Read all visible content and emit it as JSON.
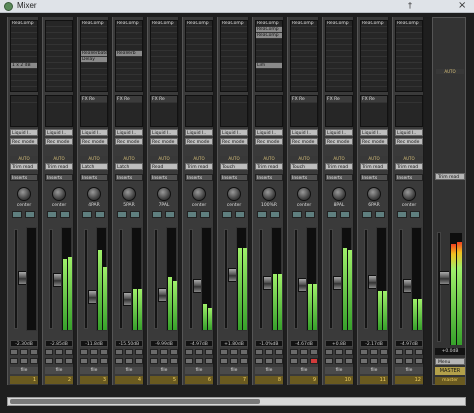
{
  "window": {
    "title": "Mixer",
    "pin_glyph": "†",
    "close_glyph": "×"
  },
  "strips": [
    {
      "fx": [
        "ReaComp",
        "",
        "",
        "",
        "",
        "",
        "",
        "1 x 2 dB",
        "",
        "",
        ""
      ],
      "send": "",
      "input": "Liquid I..",
      "recmode": "Rec mode",
      "automode": "Trim read",
      "auto": "AUTO",
      "inserts": "Inserts",
      "pan": "center",
      "db": "-2.30dB",
      "name": "",
      "num": "1",
      "meter": [
        0.0,
        0.0
      ],
      "fader": 0.52
    },
    {
      "fx": [
        "",
        "",
        "",
        "",
        "",
        "",
        "",
        "",
        "",
        "",
        ""
      ],
      "send": "",
      "input": "Liquid I..",
      "recmode": "Rec mode",
      "automode": "Trim read",
      "auto": "AUTO",
      "inserts": "Inserts",
      "pan": "center",
      "db": "-2.85dB",
      "name": "",
      "num": "2",
      "meter": [
        0.7,
        0.72
      ],
      "fader": 0.5
    },
    {
      "fx": [
        "ReaComp",
        "",
        "",
        "",
        "",
        "ReaVerbate",
        "Delay",
        "",
        "",
        "",
        ""
      ],
      "send": "FX Re",
      "input": "Liquid I..",
      "recmode": "Rec mode",
      "automode": "Latch",
      "auto": "AUTO",
      "inserts": "Inserts",
      "pan": "4PAR",
      "db": "-11.8dB",
      "name": "",
      "num": "3",
      "meter": [
        0.78,
        0.62
      ],
      "fader": 0.3
    },
    {
      "fx": [
        "ReaComp",
        "",
        "",
        "",
        "",
        "ReaVerb",
        "",
        "",
        "",
        "",
        ""
      ],
      "send": "FX Re",
      "input": "Liquid I..",
      "recmode": "Rec mode",
      "automode": "Latch",
      "auto": "AUTO",
      "inserts": "Inserts",
      "pan": "5PAR",
      "db": "-15.50dB",
      "name": "",
      "num": "4",
      "meter": [
        0.4,
        0.4
      ],
      "fader": 0.28
    },
    {
      "fx": [
        "ReaComp",
        "",
        "",
        "",
        "",
        "",
        "",
        "",
        "",
        "",
        ""
      ],
      "send": "FX Re",
      "input": "Liquid I..",
      "recmode": "Rec mode",
      "automode": "Read",
      "auto": "AUTO",
      "inserts": "Inserts",
      "pan": "7PAL",
      "db": "-9.99dB",
      "name": "",
      "num": "5",
      "meter": [
        0.52,
        0.48
      ],
      "fader": 0.33
    },
    {
      "fx": [
        "ReaComp",
        "",
        "",
        "",
        "",
        "",
        "",
        "",
        "",
        "",
        ""
      ],
      "send": "",
      "input": "Liquid I..",
      "recmode": "Rec mode",
      "automode": "Trim read",
      "auto": "AUTO",
      "inserts": "Inserts",
      "pan": "center",
      "db": "-4.97dB",
      "name": "",
      "num": "6",
      "meter": [
        0.25,
        0.22
      ],
      "fader": 0.43
    },
    {
      "fx": [
        "ReaComp",
        "",
        "",
        "",
        "",
        "",
        "",
        "",
        "",
        "",
        ""
      ],
      "send": "",
      "input": "Liquid I..",
      "recmode": "Rec mode",
      "automode": "Touch",
      "auto": "AUTO",
      "inserts": "Inserts",
      "pan": "center",
      "db": "+1.80dB",
      "name": "",
      "num": "7",
      "meter": [
        0.8,
        0.8
      ],
      "fader": 0.56
    },
    {
      "fx": [
        "ReaComp",
        "ReaComp",
        "ReaComp",
        "",
        "",
        "",
        "",
        "Lim",
        "",
        "",
        ""
      ],
      "send": "",
      "input": "Liquid I..",
      "recmode": "Rec mode",
      "automode": "Trim read",
      "auto": "AUTO",
      "inserts": "Inserts",
      "pan": "100%R",
      "db": "-1.0%dB",
      "name": "",
      "num": "8",
      "meter": [
        0.55,
        0.55
      ],
      "fader": 0.46
    },
    {
      "fx": [
        "ReaComp",
        "",
        "",
        "",
        "",
        "",
        "",
        "",
        "",
        "",
        ""
      ],
      "send": "FX Re",
      "input": "Liquid I..",
      "recmode": "Rec mode",
      "automode": "Touch",
      "auto": "AUTO",
      "inserts": "Inserts",
      "pan": "center",
      "db": "-4.67dB",
      "name": "",
      "num": "9",
      "meter": [
        0.45,
        0.45
      ],
      "fader": 0.44
    },
    {
      "fx": [
        "ReaComp",
        "",
        "",
        "",
        "",
        "",
        "",
        "",
        "",
        "",
        ""
      ],
      "send": "FX Re",
      "input": "Liquid I..",
      "recmode": "Rec mode",
      "automode": "Trim read",
      "auto": "AUTO",
      "inserts": "Inserts",
      "pan": "8PAL",
      "db": "+0.8B",
      "name": "",
      "num": "10",
      "meter": [
        0.8,
        0.78
      ],
      "fader": 0.46
    },
    {
      "fx": [
        "ReaComp",
        "",
        "",
        "",
        "",
        "",
        "",
        "",
        "",
        "",
        ""
      ],
      "send": "FX Re",
      "input": "Liquid I..",
      "recmode": "Rec mode",
      "automode": "Trim read",
      "auto": "AUTO",
      "inserts": "Inserts",
      "pan": "6PAR",
      "db": "-2.17dB",
      "name": "",
      "num": "11",
      "meter": [
        0.38,
        0.38
      ],
      "fader": 0.48
    },
    {
      "fx": [
        "ReaComp",
        "",
        "",
        "",
        "",
        "",
        "",
        "",
        "",
        "",
        ""
      ],
      "send": "",
      "input": "Liquid I..",
      "recmode": "Rec mode",
      "automode": "Trim read",
      "auto": "AUTO",
      "inserts": "Inserts",
      "pan": "center",
      "db": "-4.97dB",
      "name": "",
      "num": "12",
      "meter": [
        0.3,
        0.3
      ],
      "fader": 0.43
    }
  ],
  "master": {
    "auto": "AUTO",
    "automode": "Trim read",
    "menu": "Menu",
    "mode": "Stereo",
    "db": "+0.0dB",
    "label": "MASTER",
    "foot": "master",
    "meter": [
      0.9,
      0.92
    ],
    "fader": 0.6
  },
  "footer_label": "master",
  "file_label": "file",
  "scroll": {
    "thumb_fraction": 0.55
  }
}
